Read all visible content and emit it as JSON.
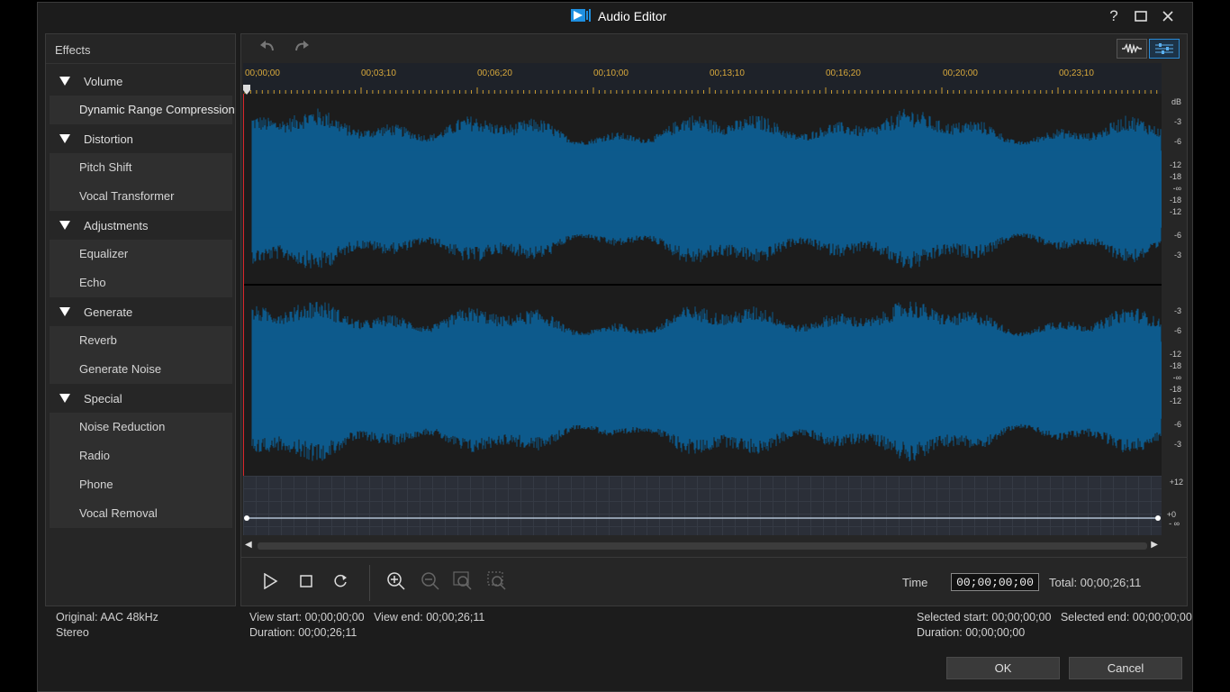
{
  "window": {
    "title": "Audio Editor"
  },
  "titlebar_controls": {
    "help": "?",
    "maximize": "maximize",
    "close": "close"
  },
  "effects": {
    "header": "Effects",
    "categories": [
      {
        "label": "Volume",
        "items": [
          "Dynamic Range Compression"
        ]
      },
      {
        "label": "Distortion",
        "items": [
          "Pitch Shift",
          "Vocal Transformer"
        ]
      },
      {
        "label": "Adjustments",
        "items": [
          "Equalizer",
          "Echo"
        ]
      },
      {
        "label": "Generate",
        "items": [
          "Reverb",
          "Generate Noise"
        ]
      },
      {
        "label": "Special",
        "items": [
          "Noise Reduction",
          "Radio",
          "Phone",
          "Vocal Removal"
        ]
      }
    ]
  },
  "ruler": {
    "ticks": [
      "00;00;00",
      "00;03;10",
      "00;06;20",
      "00;10;00",
      "00;13;10",
      "00;16;20",
      "00;20;00",
      "00;23;10"
    ]
  },
  "db_scale": {
    "unit": "dB",
    "channel1": [
      "-3",
      "-6",
      "-12",
      "-18",
      "-∞",
      "-18",
      "-12",
      "-6",
      "-3"
    ],
    "channel2": [
      "-3",
      "-6",
      "-12",
      "-18",
      "-∞",
      "-18",
      "-12",
      "-6",
      "-3"
    ]
  },
  "volume_scale": {
    "top": "+12",
    "zero": "+0",
    "bottom": "- ∞"
  },
  "playback": {
    "time_label": "Time",
    "time_value": "00;00;00;00",
    "total": "Total: 00;00;26;11"
  },
  "status": {
    "original": "Original: AAC 48kHz",
    "channels": "Stereo",
    "view_start": "View start: 00;00;00;00",
    "view_end": "View end: 00;00;26;11",
    "view_duration": "Duration: 00;00;26;11",
    "selected_start": "Selected start: 00;00;00;00",
    "selected_end": "Selected end: 00;00;00;00",
    "selected_duration": "Duration: 00;00;00;00"
  },
  "buttons": {
    "ok": "OK",
    "cancel": "Cancel"
  },
  "colors": {
    "waveform": "#0d5a8c",
    "ruler_text": "#d8a93c",
    "playhead": "#d9262b",
    "accent": "#2a8ad4"
  }
}
